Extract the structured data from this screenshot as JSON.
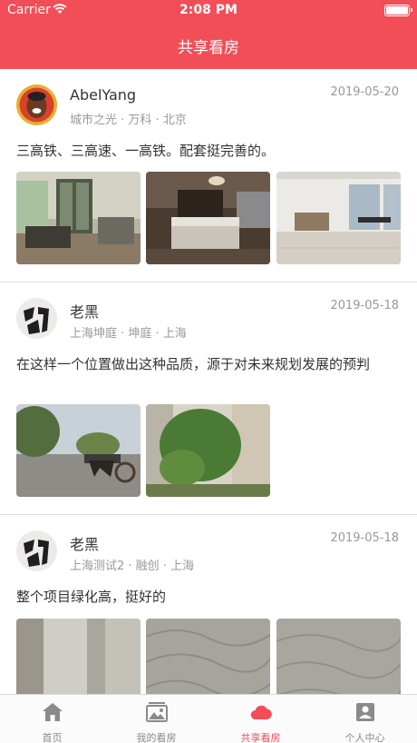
{
  "status_bar": {
    "carrier": "Carrier",
    "time": "2:08 PM"
  },
  "nav": {
    "title": "共享看房"
  },
  "posts": [
    {
      "user": "AbelYang",
      "meta": "城市之光 · 万科 · 北京",
      "date": "2019-05-20",
      "text": "三高铁、三高速、一高铁。配套挺完善的。"
    },
    {
      "user": "老黑",
      "meta": "上海坤庭 · 坤庭 · 上海",
      "date": "2019-05-18",
      "text": "在这样一个位置做出这种品质，源于对未来规划发展的预判"
    },
    {
      "user": "老黑",
      "meta": "上海测试2 · 融创 · 上海",
      "date": "2019-05-18",
      "text": "整个项目绿化高，挺好的"
    }
  ],
  "tabs": [
    {
      "label": "首页",
      "icon": "home-icon",
      "active": false
    },
    {
      "label": "我的看房",
      "icon": "gallery-icon",
      "active": false
    },
    {
      "label": "共享看房",
      "icon": "cloud-icon",
      "active": true
    },
    {
      "label": "个人中心",
      "icon": "person-icon",
      "active": false
    }
  ],
  "colors": {
    "accent": "#f24e58",
    "meta_text": "#999999",
    "tab_inactive": "#8a8a8a"
  }
}
